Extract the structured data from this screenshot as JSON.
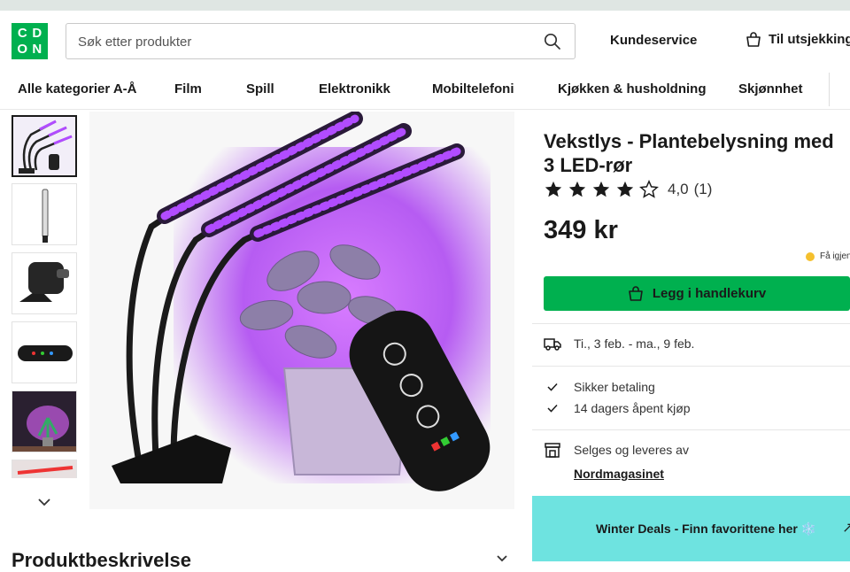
{
  "header": {
    "logo_letters": [
      "C",
      "D",
      "O",
      "N"
    ],
    "search_placeholder": "Søk etter produkter",
    "customer_service": "Kundeservice",
    "checkout": "Til utsjekking"
  },
  "nav": {
    "items": [
      "Alle kategorier A-Å",
      "Film",
      "Spill",
      "Elektronikk",
      "Mobiltelefoni",
      "Kjøkken & husholdning",
      "Skjønnhet"
    ]
  },
  "product": {
    "title": "Vekstlys - Plantebelysning med 3 LED-rør",
    "rating_value": "4,0",
    "rating_count": "(1)",
    "stars_filled": 4,
    "stars_total": 5,
    "price": "349 kr",
    "stock_text": "Få igjen",
    "add_to_cart": "Legg i handlekurv",
    "delivery": "Ti., 3 feb. - ma., 9 feb.",
    "usps": [
      "Sikker betaling",
      "14 dagers åpent kjøp"
    ],
    "seller_label": "Selges og leveres av",
    "seller_name": "Nordmagasinet"
  },
  "promo": {
    "text": "Winter Deals - Finn favorittene her ❄️"
  },
  "description": {
    "title": "Produktbeskrivelse"
  },
  "colors": {
    "brand_green": "#00b04f",
    "promo_cyan": "#6ee3e0",
    "stock_yellow": "#f5c02e",
    "grow_light_purple": "#b14cff"
  }
}
